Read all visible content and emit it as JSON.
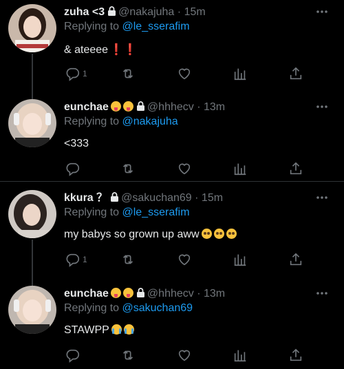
{
  "tweets": [
    {
      "name": "zuha <3",
      "handle": "@nakajuha",
      "dot": "·",
      "time": "15m",
      "replying_prefix": "Replying to",
      "replying_mention": "@le_sserafim",
      "body": "& ateeee",
      "body_suffix": "❗❗",
      "reply_count": "1",
      "name_emojis": [],
      "body_emojis": []
    },
    {
      "name": "eunchae",
      "handle": "@hhhecv",
      "dot": "·",
      "time": "13m",
      "replying_prefix": "Replying to",
      "replying_mention": "@nakajuha",
      "body": "<333",
      "reply_count": "",
      "name_emojis": [
        "tongue-emoji",
        "tongue-emoji"
      ],
      "body_emojis": []
    },
    {
      "name": "kkura ？",
      "handle": "@sakuchan69",
      "dot": "·",
      "time": "15m",
      "replying_prefix": "Replying to",
      "replying_mention": "@le_sserafim",
      "body": "my babys so grown up aww",
      "reply_count": "1",
      "name_emojis": [],
      "body_emojis": [
        "pleading-emoji",
        "pleading-emoji",
        "pleading-emoji"
      ]
    },
    {
      "name": "eunchae",
      "handle": "@hhhecv",
      "dot": "·",
      "time": "13m",
      "replying_prefix": "Replying to",
      "replying_mention": "@sakuchan69",
      "body": "STAWPP",
      "reply_count": "",
      "name_emojis": [
        "tongue-emoji",
        "tongue-emoji"
      ],
      "body_emojis": [
        "crying-emoji",
        "crying-emoji"
      ]
    }
  ],
  "colors": {
    "background": "#000000",
    "text": "#e7e9ea",
    "muted": "#71767b",
    "link": "#1d9bf0",
    "divider": "#2f3336"
  },
  "icons": [
    "lock-icon",
    "more-icon",
    "reply-icon",
    "retweet-icon",
    "like-icon",
    "views-icon",
    "share-icon"
  ]
}
